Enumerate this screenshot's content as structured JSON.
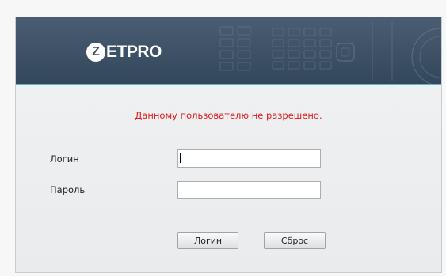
{
  "header": {
    "logo_mark": "Z",
    "logo_text": "ETPRO"
  },
  "login_form": {
    "error_message": "Данному пользователю не разрешено.",
    "login_label": "Логин",
    "password_label": "Пароль",
    "login_value": "",
    "password_value": "",
    "login_button_label": "Логин",
    "reset_button_label": "Сброс"
  },
  "colors": {
    "banner": "#3d5063",
    "accent_line": "#5fb3d6",
    "error_text": "#e31b1b"
  }
}
